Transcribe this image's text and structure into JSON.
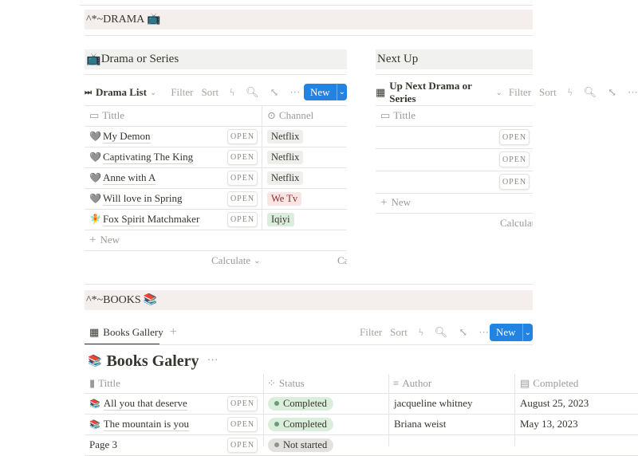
{
  "drama_section": {
    "heading": "^*~DRAMA",
    "icon": "tv-icon"
  },
  "drama_block": {
    "title": "Drama or Series"
  },
  "next_block": {
    "title": "Next Up"
  },
  "drama_list": {
    "view_name": "Drama List",
    "filter": "Filter",
    "sort": "Sort",
    "new": "New",
    "columns": [
      "Tittle",
      "Channel"
    ],
    "rows": [
      {
        "title": "My Demon",
        "channel": "Netflix",
        "icon": "grey-heart",
        "channel_color": "#eeeeec"
      },
      {
        "title": "Captivating The King",
        "channel": "Netflix",
        "icon": "grey-heart",
        "channel_color": "#eeeeec"
      },
      {
        "title": "Anne with A",
        "channel": "Netflix",
        "icon": "grey-heart",
        "channel_color": "#eeeeec"
      },
      {
        "title": "Will love in Spring",
        "channel": "We Tv",
        "icon": "grey-heart",
        "channel_color": "#fbe4e4"
      },
      {
        "title": "Fox Spirit Matchmaker",
        "channel": "Iqiyi",
        "icon": "fairy",
        "channel_color": "#dbeddb"
      }
    ],
    "open_label": "OPEN",
    "add_new": "New",
    "calculate": "Calculate",
    "calculate_cut": "Ca"
  },
  "up_next": {
    "view_name": "Up Next Drama or Series",
    "filter": "Filter",
    "sort": "Sort",
    "columns": [
      "Tittle"
    ],
    "open_label": "OPEN",
    "row_count": 3,
    "add_new": "New",
    "calculate": "Calculate"
  },
  "books_section": {
    "heading": "^*~BOOKS",
    "icon": "books-icon"
  },
  "books": {
    "tab": "Books Gallery",
    "filter": "Filter",
    "sort": "Sort",
    "new": "New",
    "title": "Books Galery",
    "columns": [
      "Tittle",
      "Status",
      "Author",
      "Completed"
    ],
    "rows": [
      {
        "title": "All you that deserve",
        "status": "Completed",
        "author": "jacqueline whitney",
        "completed": "August 25, 2023"
      },
      {
        "title": "The mountain is you",
        "status": "Completed",
        "author": "Briana weist",
        "completed": "May 13, 2023"
      },
      {
        "title": "Page 3",
        "status": "Not started",
        "author": "",
        "completed": ""
      }
    ],
    "open_label": "OPEN"
  },
  "colors": {
    "accent": "#2383e2",
    "completed_bg": "#dbeddb",
    "completed_dot": "#6c9b7d",
    "not_started_bg": "#e3e2e0"
  }
}
